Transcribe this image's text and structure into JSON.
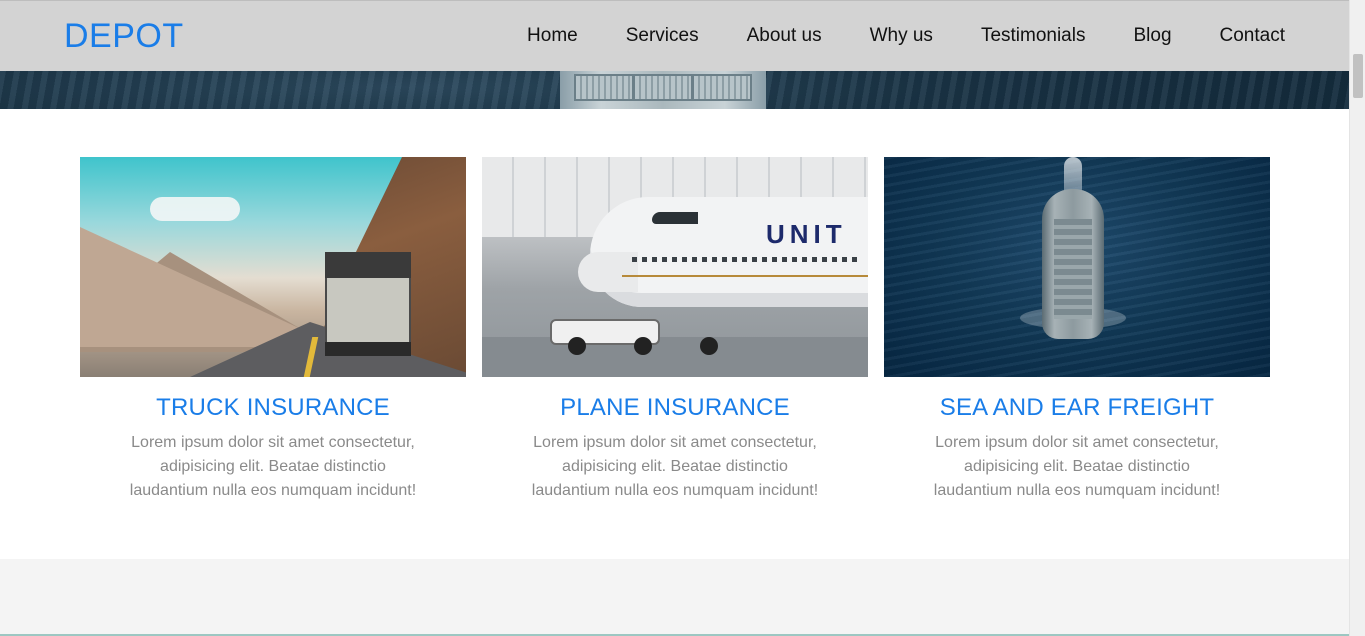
{
  "brand": {
    "name": "DEPOT"
  },
  "nav": {
    "items": [
      {
        "label": "Home"
      },
      {
        "label": "Services"
      },
      {
        "label": "About us"
      },
      {
        "label": "Why us"
      },
      {
        "label": "Testimonials"
      },
      {
        "label": "Blog"
      },
      {
        "label": "Contact"
      }
    ]
  },
  "services": [
    {
      "title": "TRUCK INSURANCE",
      "description": "Lorem ipsum dolor sit amet consectetur, adipisicing elit. Beatae distinctio laudantium nulla eos numquam incidunt!"
    },
    {
      "title": "PLANE INSURANCE",
      "description": "Lorem ipsum dolor sit amet consectetur, adipisicing elit. Beatae distinctio laudantium nulla eos numquam incidunt!",
      "plane_livery": "UNIT"
    },
    {
      "title": "SEA AND EAR FREIGHT",
      "description": "Lorem ipsum dolor sit amet consectetur, adipisicing elit. Beatae distinctio laudantium nulla eos numquam incidunt!"
    }
  ],
  "colors": {
    "brand_blue": "#1a7de8",
    "navbar_bg": "#d3d3d3",
    "body_text": "#8a8a8a"
  }
}
